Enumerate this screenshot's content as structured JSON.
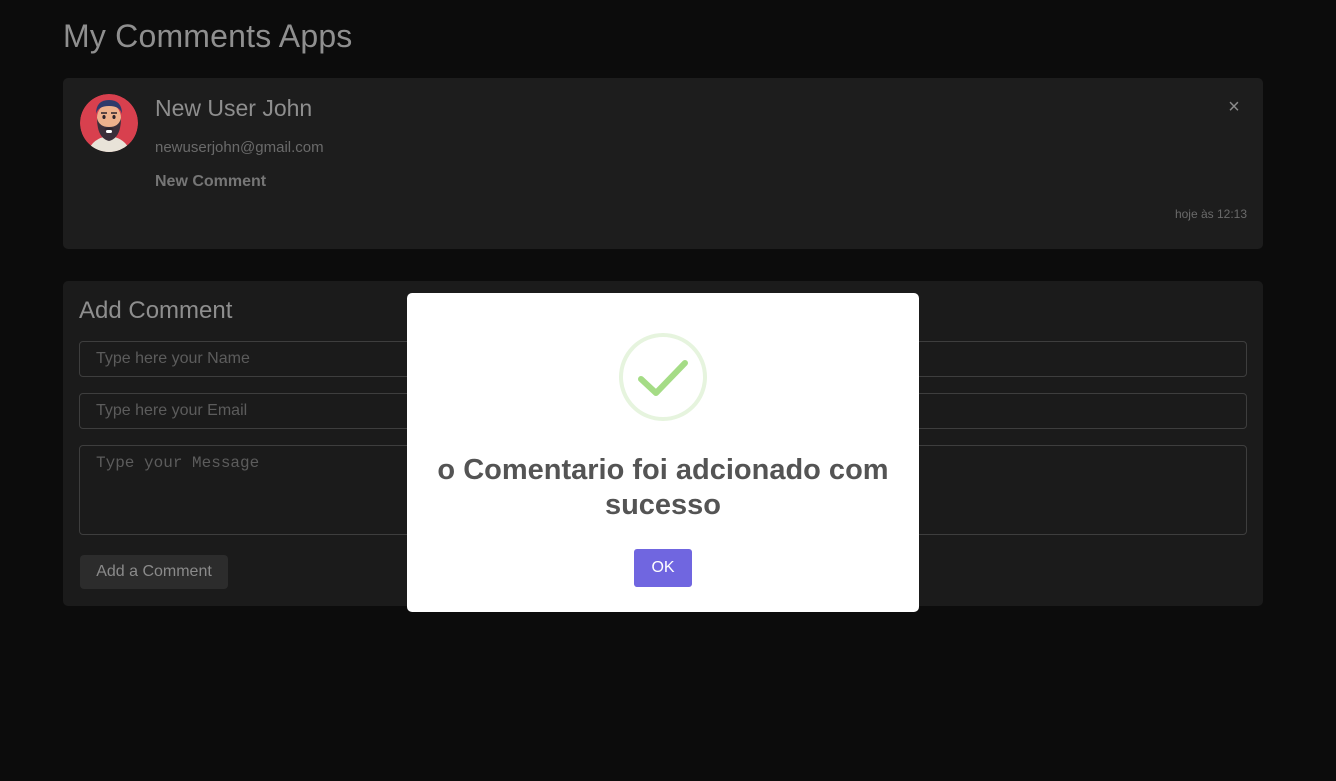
{
  "app": {
    "title": "My Comments Apps"
  },
  "comment": {
    "author_name": "New User John",
    "author_email": "newuserjohn@gmail.com",
    "message": "New Comment",
    "timestamp": "hoje às 12:13",
    "close_label": "×",
    "avatar_icon": "bearded-man-avatar"
  },
  "form": {
    "title": "Add Comment",
    "name_placeholder": "Type here your Name",
    "email_placeholder": "Type here your Email",
    "message_placeholder": "Type your Message",
    "submit_label": "Add a Comment"
  },
  "modal": {
    "icon": "success-check-icon",
    "title": "o Comentario foi adcionado com sucesso",
    "confirm_label": "OK",
    "confirm_color": "#7066e0",
    "success_color": "#a5dc86"
  }
}
